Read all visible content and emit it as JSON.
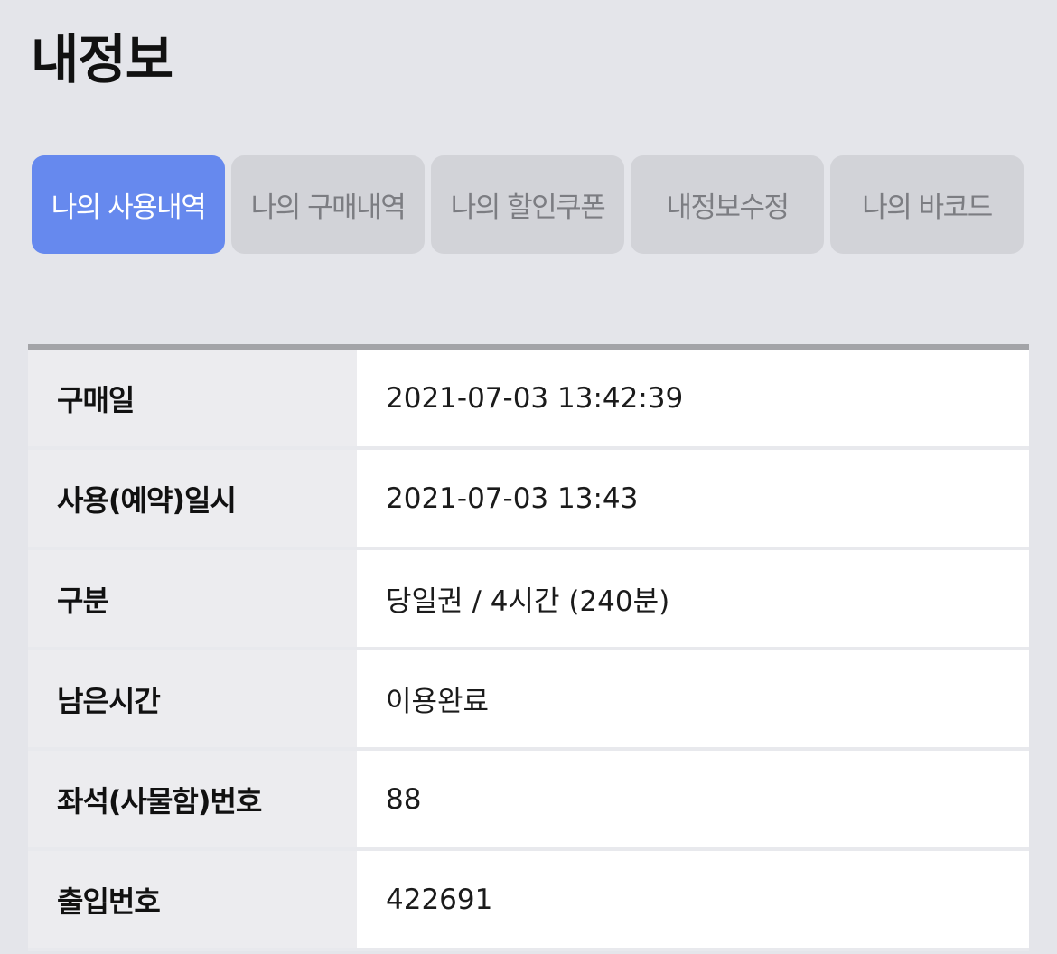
{
  "header": {
    "title": "내정보"
  },
  "tabs": [
    {
      "label": "나의 사용내역",
      "active": true
    },
    {
      "label": "나의 구매내역",
      "active": false
    },
    {
      "label": "나의 할인쿠폰",
      "active": false
    },
    {
      "label": "내정보수정",
      "active": false
    },
    {
      "label": "나의 바코드",
      "active": false
    }
  ],
  "colors": {
    "background": "#e4e5ea",
    "active_tab": "#6689ee",
    "inactive_tab": "#d2d3d8",
    "inactive_tab_text": "#7c7d82",
    "table_top_border": "#a3a4a8"
  },
  "details": {
    "rows": [
      {
        "label": "구매일",
        "value": "2021-07-03 13:42:39"
      },
      {
        "label": "사용(예약)일시",
        "value": "2021-07-03 13:43"
      },
      {
        "label": "구분",
        "value": "당일권 / 4시간 (240분)"
      },
      {
        "label": "남은시간",
        "value": "이용완료"
      },
      {
        "label": "좌석(사물함)번호",
        "value": "88"
      },
      {
        "label": "출입번호",
        "value": "422691"
      }
    ]
  }
}
